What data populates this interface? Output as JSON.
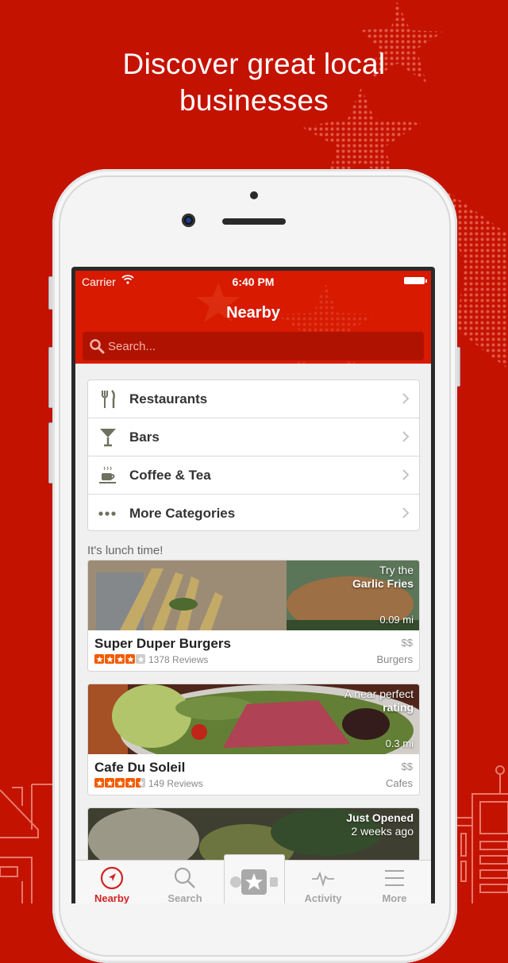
{
  "promo": {
    "headline_line1": "Discover great local",
    "headline_line2": "businesses"
  },
  "colors": {
    "background_red": "#c41200",
    "nav_red": "#d71a00",
    "accent_red": "#d32323",
    "star_orange": "#f15c00",
    "icon_olive": "#707060"
  },
  "status_bar": {
    "carrier": "Carrier",
    "time": "6:40 PM"
  },
  "nav": {
    "title": "Nearby",
    "search_placeholder": "Search..."
  },
  "categories": [
    {
      "label": "Restaurants",
      "icon": "fork-knife-icon"
    },
    {
      "label": "Bars",
      "icon": "cocktail-icon"
    },
    {
      "label": "Coffee & Tea",
      "icon": "coffee-cup-icon"
    },
    {
      "label": "More Categories",
      "icon": "ellipsis-icon"
    }
  ],
  "section_label": "It's lunch time!",
  "businesses": [
    {
      "name": "Super Duper Burgers",
      "tag_line1": "Try the",
      "tag_line2": "Garlic Fries",
      "distance": "0.09 mi",
      "price": "$$",
      "rating": 4,
      "reviews": "1378 Reviews",
      "category": "Burgers"
    },
    {
      "name": "Cafe Du Soleil",
      "tag_line1": "A near perfect",
      "tag_line2": "rating",
      "distance": "0.3 mi",
      "price": "$$",
      "rating": 4.5,
      "reviews": "149 Reviews",
      "category": "Cafes"
    },
    {
      "tag_line1": "Just Opened",
      "tag_line2": "2 weeks ago"
    }
  ],
  "tabs": [
    {
      "label": "Nearby",
      "icon": "compass-icon",
      "active": true
    },
    {
      "label": "Search",
      "icon": "search-icon",
      "active": false
    },
    {
      "label": "",
      "icon": "star-badge-icon",
      "active": false
    },
    {
      "label": "Activity",
      "icon": "pulse-icon",
      "active": false
    },
    {
      "label": "More",
      "icon": "hamburger-icon",
      "active": false
    }
  ]
}
